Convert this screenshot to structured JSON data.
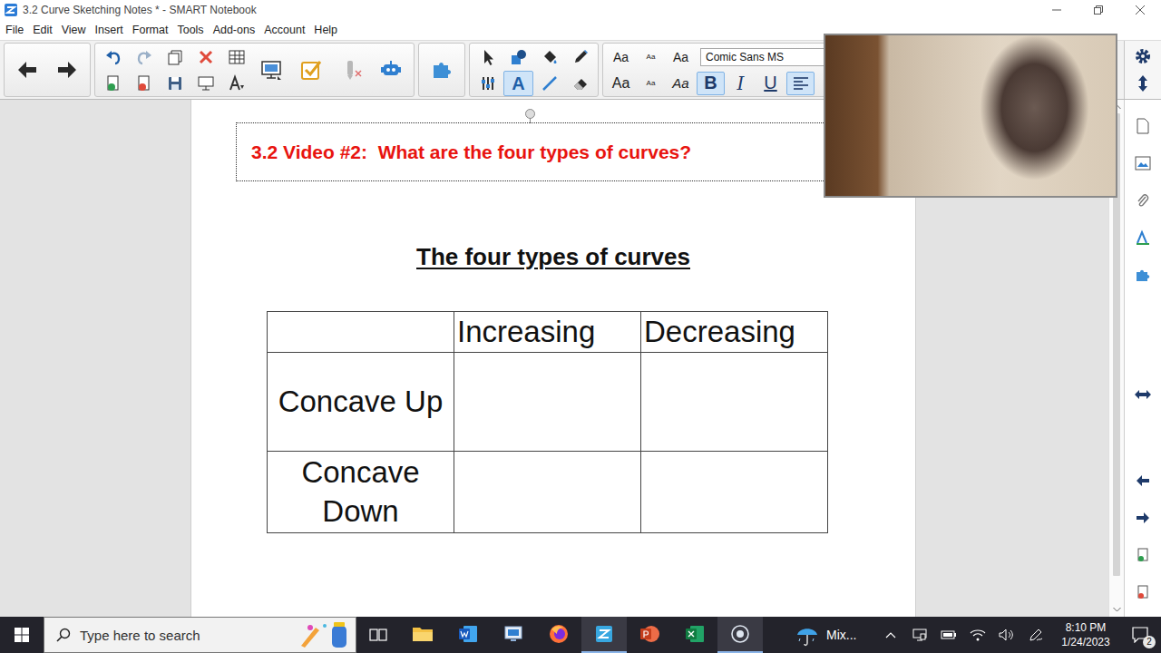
{
  "window": {
    "title": "3.2 Curve Sketching Notes * - SMART Notebook"
  },
  "menu": [
    "File",
    "Edit",
    "View",
    "Insert",
    "Format",
    "Tools",
    "Add-ons",
    "Account",
    "Help"
  ],
  "toolbar": {
    "draw_tools": [
      {
        "kind": "select",
        "label": "",
        "selected": false
      },
      {
        "kind": "shape",
        "label": "",
        "selected": false
      },
      {
        "kind": "fill",
        "label": "",
        "selected": false
      },
      {
        "kind": "pen",
        "label": "",
        "selected": false
      },
      {
        "kind": "properties",
        "label": "",
        "selected": false
      },
      {
        "kind": "text",
        "label": "A",
        "selected": true
      },
      {
        "kind": "line",
        "label": "",
        "selected": false
      },
      {
        "kind": "eraser",
        "label": "",
        "selected": false
      }
    ],
    "size_buttons": [
      {
        "label": "Aa",
        "kind": "regular"
      },
      {
        "label": "Aa",
        "kind": "tiny"
      },
      {
        "label": "Aa",
        "kind": "regular"
      },
      {
        "label": "Aa",
        "kind": "large"
      },
      {
        "label": "Aa",
        "kind": "tiny"
      },
      {
        "label": "Aa",
        "kind": "italic"
      }
    ],
    "font": "Comic Sans MS",
    "styles": [
      {
        "label": "B",
        "kind": "bold",
        "selected": true
      },
      {
        "label": "I",
        "kind": "italic",
        "selected": false
      },
      {
        "label": "U",
        "kind": "underline",
        "selected": false
      }
    ],
    "align": [
      {
        "kind": "left",
        "selected": true
      },
      {
        "kind": "center",
        "selected": false
      }
    ]
  },
  "page": {
    "title": "3.2 Video #2:  What are the four types of curves?",
    "title_selected": true,
    "heading": "The four types of curves",
    "table": {
      "columns": [
        "",
        "Increasing",
        "Decreasing"
      ],
      "rows": [
        {
          "label": "Concave Up",
          "cells": [
            "",
            ""
          ]
        },
        {
          "label": "Concave Down",
          "cells": [
            "",
            ""
          ]
        }
      ]
    }
  },
  "taskbar": {
    "search": {
      "placeholder": "Type here to search"
    },
    "apps": [
      {
        "kind": "explorer",
        "active": false
      },
      {
        "kind": "word",
        "active": false
      },
      {
        "kind": "remote",
        "active": false
      },
      {
        "kind": "firefox",
        "active": false
      },
      {
        "kind": "smart",
        "active": true
      },
      {
        "kind": "powerpoint",
        "active": false
      },
      {
        "kind": "excel",
        "active": false
      },
      {
        "kind": "recorder",
        "active": true
      }
    ],
    "weather": "Mix...",
    "time": "8:10 PM",
    "date": "1/24/2023",
    "notifications": "2"
  }
}
